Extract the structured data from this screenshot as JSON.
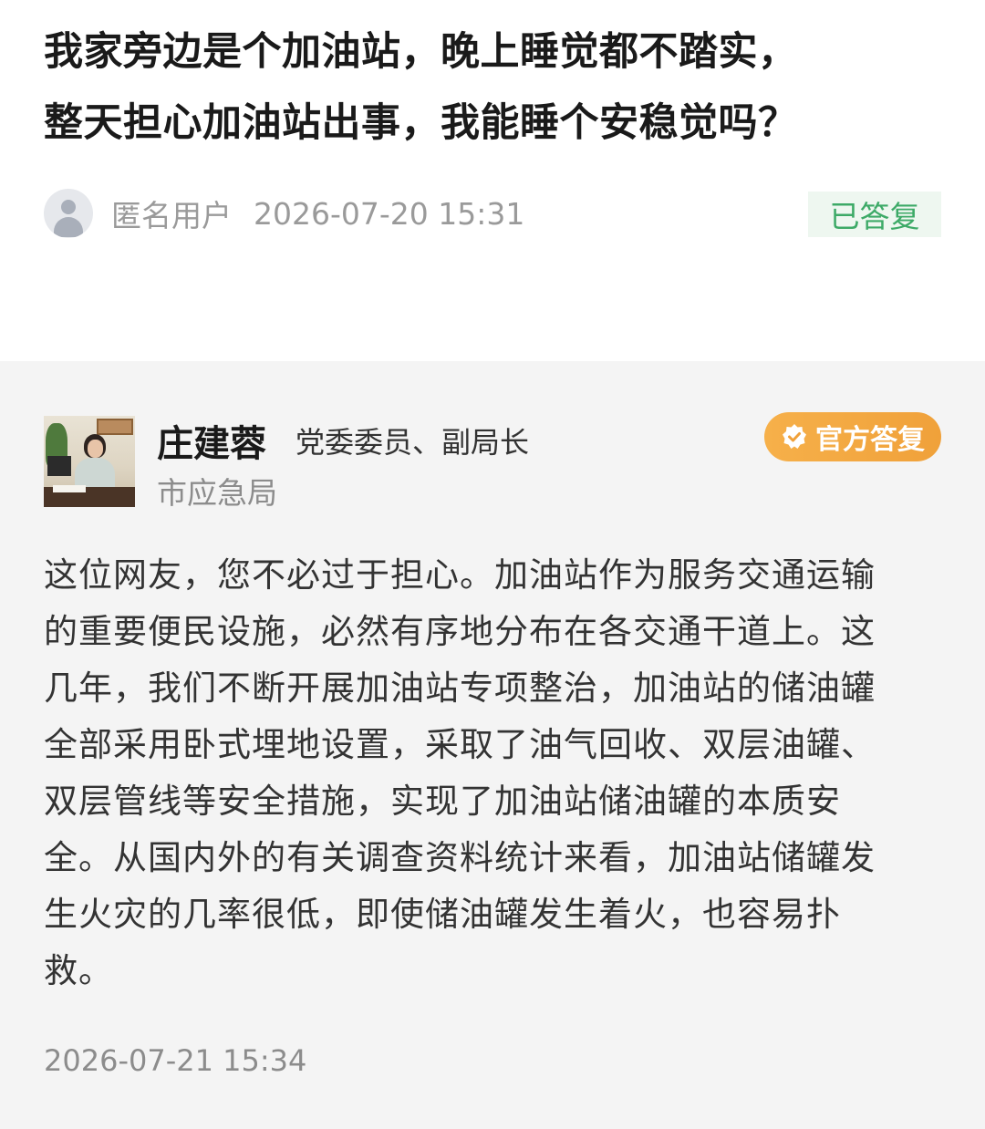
{
  "question": {
    "title_line1": "我家旁边是个加油站，晚上睡觉都不踏实，",
    "title_line2": "整天担心加油站出事，我能睡个安稳觉吗？",
    "asker_name": "匿名用户",
    "asked_at": "2026-07-20 15:31",
    "status": "已答复",
    "status_color": "#3daa67",
    "avatar_icon": "user-icon"
  },
  "answer": {
    "official_name": "庄建蓉",
    "official_title": "党委委员、副局长",
    "department": "市应急局",
    "badge_label": "官方答复",
    "badge_icon": "verified-shield-icon",
    "badge_color": "#f0a13a",
    "lines": [
      "这位网友，您不必过于担心。加油站作为服务交通运输",
      "的重要便民设施，必然有序地分布在各交通干道上。这",
      "几年，我们不断开展加油站专项整治，加油站的储油罐",
      "全部采用卧式埋地设置，采取了油气回收、双层油罐、",
      "双层管线等安全措施，实现了加油站储油罐的本质安",
      "全。从国内外的有关调查资料统计来看，加油站储罐发",
      "生火灾的几率很低，即使储油罐发生着火，也容易扑",
      "救。"
    ],
    "answered_at": "2026-07-21 15:34"
  }
}
